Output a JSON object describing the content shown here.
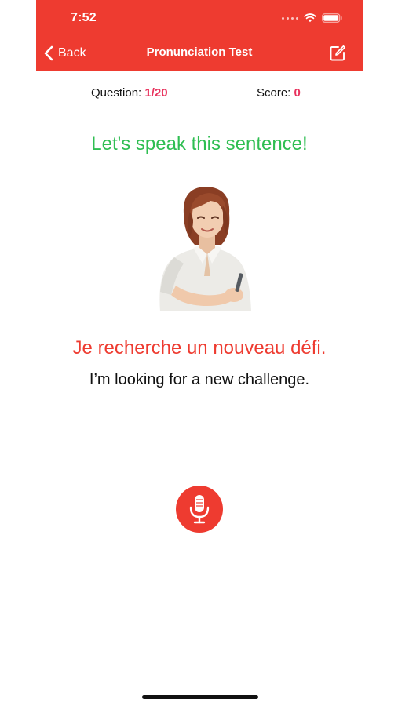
{
  "status_bar": {
    "time": "7:52",
    "icons": [
      "signal-dots-icon",
      "wifi-icon",
      "battery-icon"
    ]
  },
  "nav": {
    "back_label": "Back",
    "title": "Pronunciation Test",
    "edit_icon": "edit-icon"
  },
  "stats": {
    "question_label": "Question:",
    "question_value": "1/20",
    "score_label": "Score:",
    "score_value": "0"
  },
  "content": {
    "instruction": "Let's speak this sentence!",
    "sentence": "Je recherche un nouveau défi.",
    "translation": "I’m looking for a new challenge."
  },
  "actions": {
    "mic_icon": "microphone-icon"
  },
  "colors": {
    "header": "#ee3b30",
    "instruction": "#2fbe52",
    "sentence": "#ee3b30",
    "accent": "#e8335e"
  }
}
